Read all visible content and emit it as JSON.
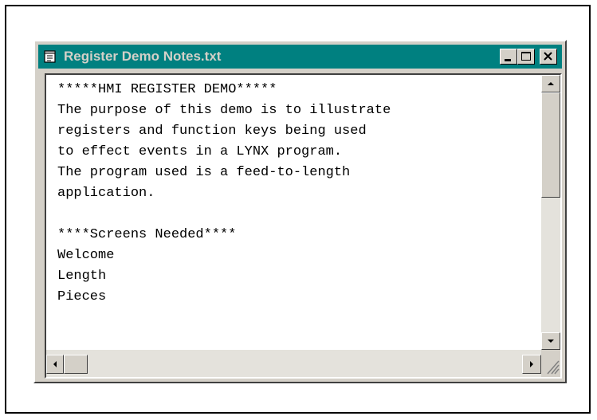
{
  "window": {
    "title": "Register Demo Notes.txt",
    "buttons": {
      "minimize": "_",
      "maximize": "□",
      "close": "×"
    }
  },
  "document": {
    "lines": [
      "*****HMI REGISTER DEMO*****",
      "The purpose of this demo is to illustrate",
      "registers and function keys being used",
      "to effect events in a LYNX program.",
      "The program used is a feed-to-length",
      "application.",
      "",
      "****Screens Needed****",
      "Welcome",
      "Length",
      "Pieces"
    ]
  },
  "colors": {
    "titlebar": "#008080",
    "face": "#d4d0c8",
    "title_text": "#d4d0c8"
  },
  "icons": [
    "document-icon",
    "minimize-icon",
    "maximize-icon",
    "close-icon",
    "scroll-up-arrow-icon",
    "scroll-down-arrow-icon",
    "scroll-left-arrow-icon",
    "scroll-right-arrow-icon",
    "resize-grip-icon"
  ]
}
